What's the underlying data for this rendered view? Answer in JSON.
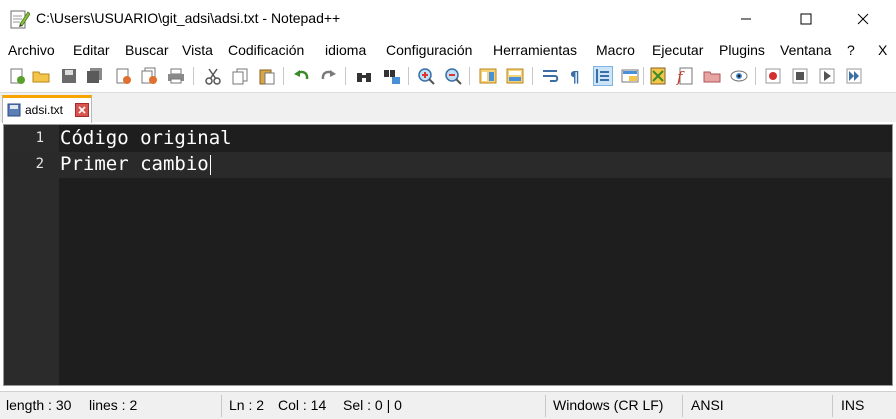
{
  "window": {
    "title": "C:\\Users\\USUARIO\\git_adsi\\adsi.txt - Notepad++",
    "icons": {
      "app": "notepadpp-icon",
      "minimize": "minimize-icon",
      "maximize": "maximize-icon",
      "close": "close-icon"
    }
  },
  "menu": {
    "items": [
      "Archivo",
      "Editar",
      "Buscar",
      "Vista",
      "Codificación",
      "idioma",
      "Configuración",
      "Herramientas",
      "Macro",
      "Ejecutar",
      "Plugins",
      "Ventana",
      "?"
    ],
    "close_glyph": "X"
  },
  "toolbar": {
    "icons": [
      "new-file-icon",
      "open-file-icon",
      "save-icon",
      "save-all-icon",
      "close-icon",
      "close-all-icon",
      "print-icon",
      "cut-icon",
      "copy-icon",
      "paste-icon",
      "undo-icon",
      "redo-icon",
      "find-icon",
      "replace-icon",
      "zoom-in-icon",
      "zoom-out-icon",
      "sync-vertical-icon",
      "sync-horizontal-icon",
      "word-wrap-icon",
      "show-all-chars-icon",
      "indent-guide-icon",
      "user-defined-lang-icon",
      "doc-map-icon",
      "function-list-icon",
      "folder-workspace-icon",
      "monitoring-icon",
      "record-macro-icon",
      "stop-record-icon",
      "play-macro-icon",
      "run-macro-multiple-icon"
    ]
  },
  "tab": {
    "label": "adsi.txt",
    "icons": {
      "doc": "saved-document-icon",
      "close": "tab-close-icon"
    }
  },
  "editor": {
    "lines": [
      {
        "number": "1",
        "text": "Código original"
      },
      {
        "number": "2",
        "text": "Primer cambio"
      }
    ],
    "colors": {
      "background": "#1e1e1e",
      "text": "#ffffff"
    }
  },
  "status": {
    "length": "length : 30",
    "lines": "lines : 2",
    "ln": "Ln : 2",
    "col": "Col : 14",
    "sel": "Sel : 0 | 0",
    "eol": "Windows (CR LF)",
    "encoding": "ANSI",
    "mode": "INS"
  }
}
